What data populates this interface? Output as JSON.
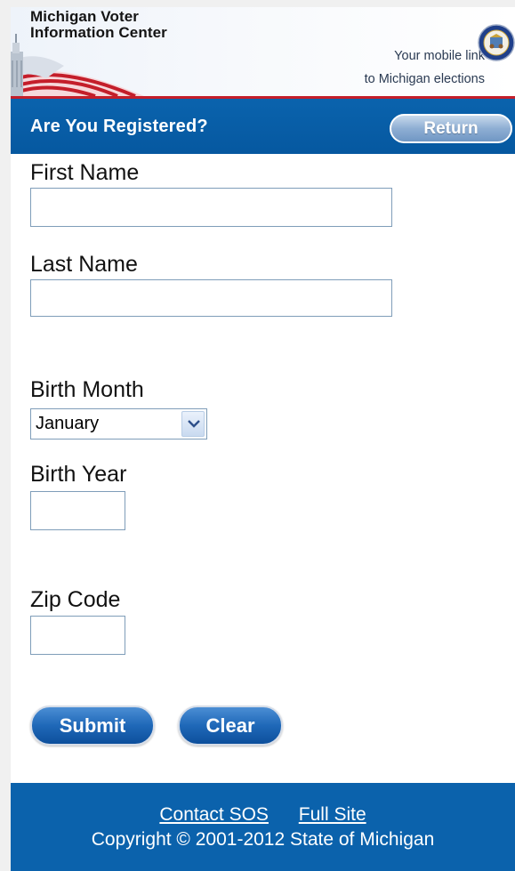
{
  "header": {
    "title_line1": "Michigan Voter",
    "title_line2": "Information Center",
    "tagline_line1": "Your mobile link",
    "tagline_line2": "to Michigan elections",
    "seal_icon": "michigan-state-seal"
  },
  "titlebar": {
    "title": "Are You Registered?",
    "return_label": "Return"
  },
  "form": {
    "first_name": {
      "label": "First Name",
      "value": ""
    },
    "last_name": {
      "label": "Last Name",
      "value": ""
    },
    "birth_month": {
      "label": "Birth Month",
      "selected": "January"
    },
    "birth_year": {
      "label": "Birth Year",
      "value": ""
    },
    "zip_code": {
      "label": "Zip Code",
      "value": ""
    },
    "submit_label": "Submit",
    "clear_label": "Clear"
  },
  "footer": {
    "contact_label": "Contact SOS",
    "full_site_label": "Full Site",
    "copyright": "Copyright © 2001-2012 State of Michigan"
  },
  "colors": {
    "brand_blue": "#0658a0",
    "accent_red": "#c41e2a",
    "button_blue": "#1f68b8"
  }
}
